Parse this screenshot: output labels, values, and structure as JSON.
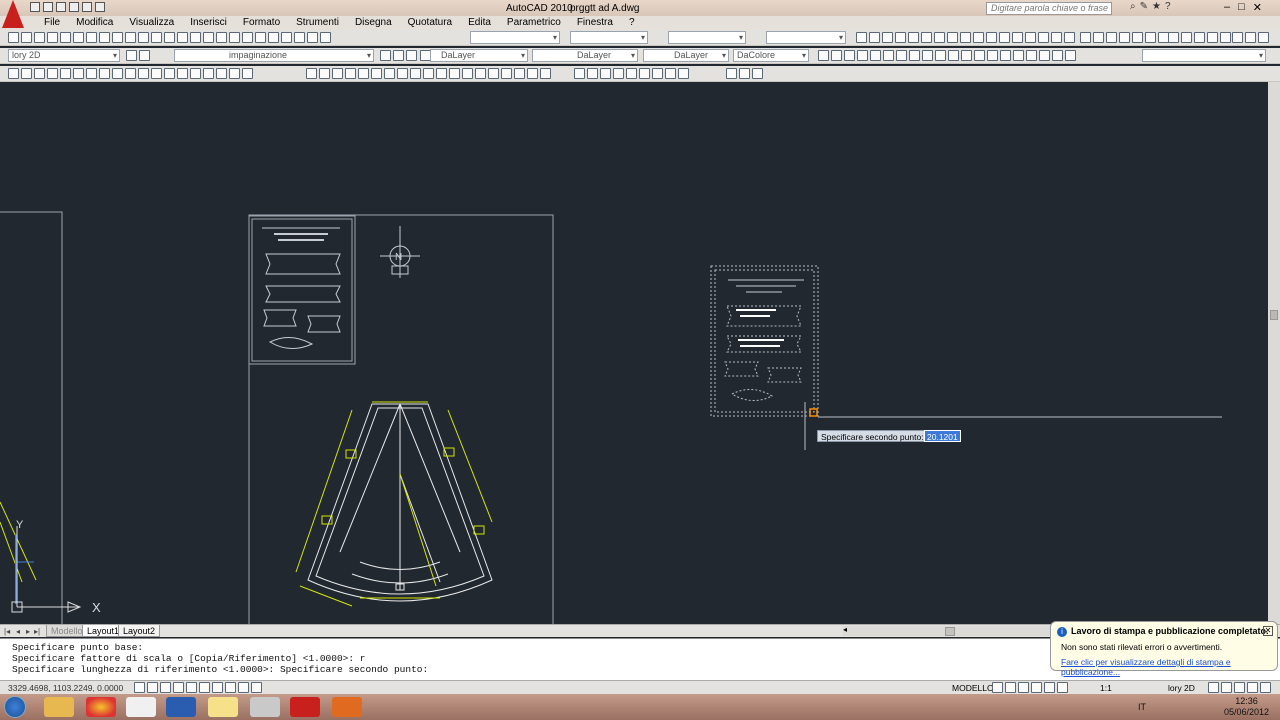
{
  "title_bar": {
    "app_name": "AutoCAD 2010",
    "file_name": "prggtt ad A.dwg",
    "search_placeholder": "Digitare parola chiave o frase"
  },
  "menu": [
    "File",
    "Modifica",
    "Visualizza",
    "Inserisci",
    "Formato",
    "Strumenti",
    "Disegna",
    "Quotatura",
    "Edita",
    "Parametrico",
    "Finestra",
    "?"
  ],
  "toolbar": {
    "workspace": "lory 2D",
    "layer": "impaginazione",
    "color": "DaLayer",
    "linetype": "DaLayer",
    "lineweight": "DaLayer",
    "plotstyle": "DaColore"
  },
  "tabs": {
    "model": "Modello",
    "layout1": "Layout1",
    "layout2": "Layout2"
  },
  "command_line": [
    "Specificare punto base:",
    "Specificare fattore di scala o [Copia/Riferimento] <1.0000>: r",
    "Specificare lunghezza di riferimento <1.0000>:  Specificare secondo punto:"
  ],
  "status_bar": {
    "coords": "3329.4698, 1103.2249, 0.0000",
    "model": "MODELLO",
    "scale": "1:1",
    "workspace": "lory 2D"
  },
  "dynamic_input": {
    "prompt": "Specificare secondo punto:",
    "value": "20.1201"
  },
  "notification": {
    "title": "Lavoro di stampa e pubblicazione completato.",
    "message": "Non sono stati rilevati errori o avvertimenti.",
    "link": "Fare clic per visualizzare dettagli di stampa e pubblicazione..."
  },
  "ucs": {
    "x_label": "X",
    "y_label": "Y"
  },
  "north_label": "N",
  "tray": {
    "lang": "IT",
    "time": "12:36",
    "date": "05/06/2012"
  },
  "colors": {
    "canvas": "#212830",
    "cad_line": "#e8e8e8",
    "highlight": "#d4e600",
    "grip": "#ff8c00"
  }
}
